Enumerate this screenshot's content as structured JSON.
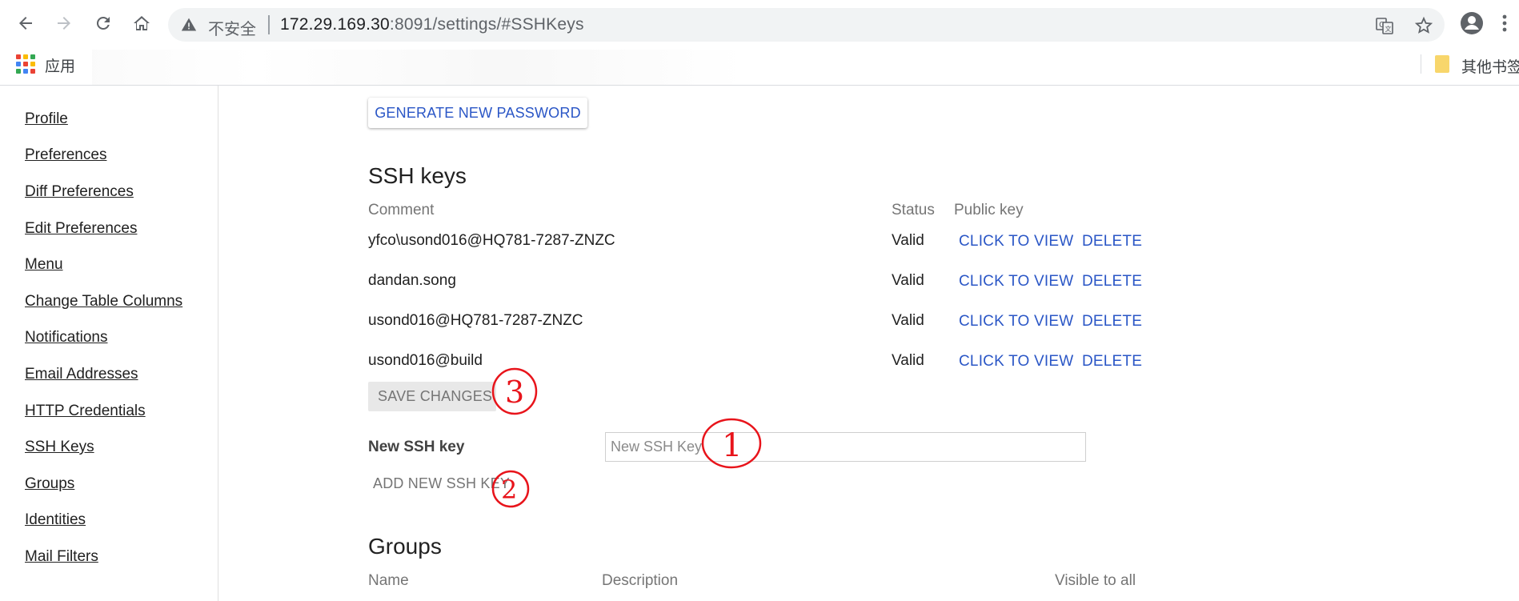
{
  "browser": {
    "security_label": "不安全",
    "url_host": "172.29.169.30",
    "url_rest": ":8091/settings/#SSHKeys",
    "apps_label": "应用",
    "other_bookmarks": "其他书签"
  },
  "sidebar": {
    "items": [
      {
        "label": "Profile"
      },
      {
        "label": "Preferences"
      },
      {
        "label": "Diff Preferences"
      },
      {
        "label": "Edit Preferences"
      },
      {
        "label": "Menu"
      },
      {
        "label": "Change Table Columns"
      },
      {
        "label": "Notifications"
      },
      {
        "label": "Email Addresses"
      },
      {
        "label": "HTTP Credentials"
      },
      {
        "label": "SSH Keys"
      },
      {
        "label": "Groups"
      },
      {
        "label": "Identities"
      },
      {
        "label": "Mail Filters"
      }
    ]
  },
  "http": {
    "generate_button": "GENERATE NEW PASSWORD"
  },
  "ssh": {
    "title": "SSH keys",
    "columns": {
      "comment": "Comment",
      "status": "Status",
      "public_key": "Public key"
    },
    "rows": [
      {
        "comment": "yfco\\usond016@HQ781-7287-ZNZC",
        "status": "Valid",
        "view": "CLICK TO VIEW",
        "delete": "DELETE"
      },
      {
        "comment": "dandan.song",
        "status": "Valid",
        "view": "CLICK TO VIEW",
        "delete": "DELETE"
      },
      {
        "comment": "usond016@HQ781-7287-ZNZC",
        "status": "Valid",
        "view": "CLICK TO VIEW",
        "delete": "DELETE"
      },
      {
        "comment": "usond016@build",
        "status": "Valid",
        "view": "CLICK TO VIEW",
        "delete": "DELETE"
      }
    ],
    "save_button": "SAVE CHANGES",
    "new_key_label": "New SSH key",
    "new_key_placeholder": "New SSH Key",
    "new_key_value": "",
    "add_button": "ADD NEW SSH KEY"
  },
  "groups": {
    "title": "Groups",
    "columns": {
      "name": "Name",
      "description": "Description",
      "visible": "Visible to all"
    }
  },
  "annotations": {
    "color": "#e8141b",
    "marks": [
      "1",
      "2",
      "3"
    ]
  },
  "colors": {
    "link": "#2a56c6",
    "text": "#212121",
    "muted": "#757575"
  }
}
